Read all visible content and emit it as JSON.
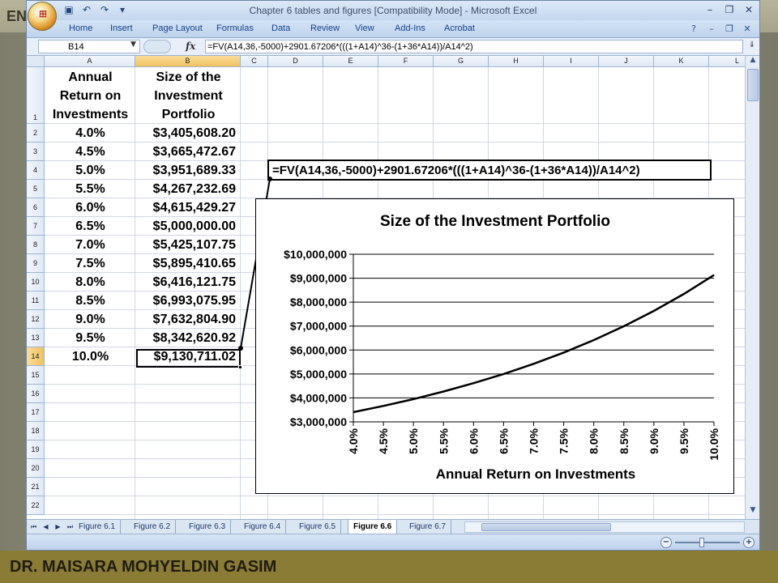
{
  "slide": {
    "title_fragment": "EN",
    "footer": "DR. MAISARA MOHYELDIN GASIM"
  },
  "window": {
    "title": "Chapter 6 tables and figures  [Compatibility Mode] - Microsoft Excel"
  },
  "ribbon": {
    "tabs": [
      "Home",
      "Insert",
      "Page Layout",
      "Formulas",
      "Data",
      "Review",
      "View",
      "Add-Ins",
      "Acrobat"
    ]
  },
  "formula_bar": {
    "name_box": "B14",
    "fx_label": "fx",
    "formula": "=FV(A14,36,-5000)+2901.67206*(((1+A14)^36-(1+36*A14))/A14^2)"
  },
  "grid": {
    "columns": [
      "A",
      "B",
      "C",
      "D",
      "E",
      "F",
      "G",
      "H",
      "I",
      "J",
      "K",
      "L"
    ],
    "rows": [
      "1",
      "2",
      "3",
      "4",
      "5",
      "6",
      "7",
      "8",
      "9",
      "10",
      "11",
      "12",
      "13",
      "14",
      "15",
      "16",
      "17",
      "18",
      "19",
      "20",
      "21",
      "22"
    ],
    "header_a": [
      "Annual",
      "Return on",
      "Investments"
    ],
    "header_b": [
      "Size of the",
      "Investment",
      "Portfolio"
    ],
    "data_rows": [
      {
        "rate": "4.0%",
        "size": "$3,405,608.20"
      },
      {
        "rate": "4.5%",
        "size": "$3,665,472.67"
      },
      {
        "rate": "5.0%",
        "size": "$3,951,689.33"
      },
      {
        "rate": "5.5%",
        "size": "$4,267,232.69"
      },
      {
        "rate": "6.0%",
        "size": "$4,615,429.27"
      },
      {
        "rate": "6.5%",
        "size": "$5,000,000.00"
      },
      {
        "rate": "7.0%",
        "size": "$5,425,107.75"
      },
      {
        "rate": "7.5%",
        "size": "$5,895,410.65"
      },
      {
        "rate": "8.0%",
        "size": "$6,416,121.75"
      },
      {
        "rate": "8.5%",
        "size": "$6,993,075.95"
      },
      {
        "rate": "9.0%",
        "size": "$7,632,804.90"
      },
      {
        "rate": "9.5%",
        "size": "$8,342,620.92"
      },
      {
        "rate": "10.0%",
        "size": "$9,130,711.02"
      }
    ]
  },
  "callout": {
    "text": "=FV(A14,36,-5000)+2901.67206*(((1+A14)^36-(1+36*A14))/A14^2)"
  },
  "chart_data": {
    "type": "line",
    "title": "Size of the Investment Portfolio",
    "xlabel": "Annual Return on Investments",
    "ylabel": "",
    "categories": [
      "4.0%",
      "4.5%",
      "5.0%",
      "5.5%",
      "6.0%",
      "6.5%",
      "7.0%",
      "7.5%",
      "8.0%",
      "8.5%",
      "9.0%",
      "9.5%",
      "10.0%"
    ],
    "series": [
      {
        "values": [
          3405608.2,
          3665472.67,
          3951689.33,
          4267232.69,
          4615429.27,
          5000000.0,
          5425107.75,
          5895410.65,
          6416121.75,
          6993075.95,
          7632804.9,
          8342620.92,
          9130711.02
        ]
      }
    ],
    "ylim": [
      3000000,
      10000000
    ],
    "yticks": [
      3000000,
      4000000,
      5000000,
      6000000,
      7000000,
      8000000,
      9000000,
      10000000
    ],
    "ytick_labels": [
      "$3,000,000",
      "$4,000,000",
      "$5,000,000",
      "$6,000,000",
      "$7,000,000",
      "$8,000,000",
      "$9,000,000",
      "$10,000,000"
    ],
    "grid": true,
    "legend": "none"
  },
  "sheet_tabs": [
    "Figure 6.1",
    "Figure 6.2",
    "Figure 6.3",
    "Figure 6.4",
    "Figure 6.5",
    "Figure 6.6",
    "Figure 6.7"
  ],
  "active_sheet": "Figure 6.6",
  "icons": {
    "office": "office-button-icon",
    "save": "save-icon",
    "undo": "undo-icon",
    "redo": "redo-icon",
    "help": "help-icon",
    "minimize": "minimize-icon",
    "restore": "restore-icon",
    "close": "close-icon"
  }
}
